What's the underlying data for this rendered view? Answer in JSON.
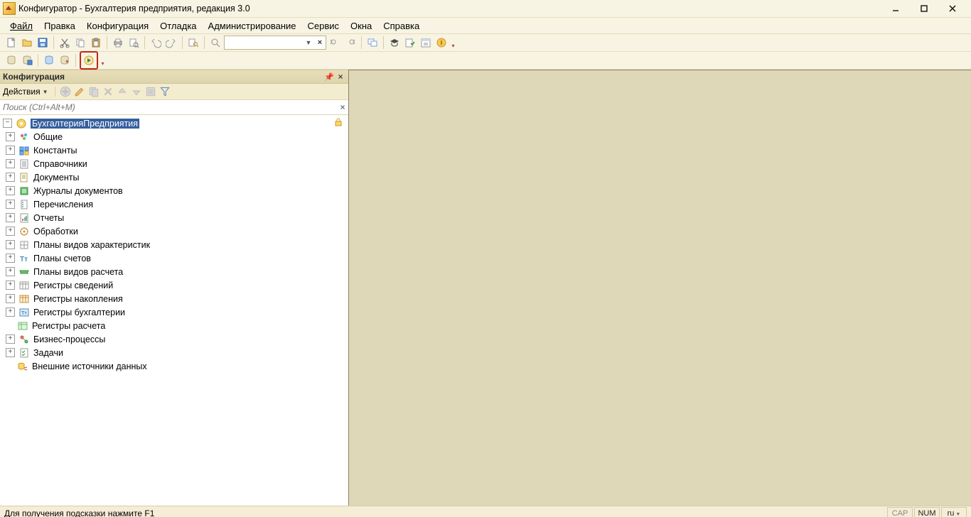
{
  "window": {
    "title": "Конфигуратор - Бухгалтерия предприятия, редакция 3.0"
  },
  "menu": {
    "file": "Файл",
    "edit": "Правка",
    "config": "Конфигурация",
    "debug": "Отладка",
    "admin": "Администрирование",
    "service": "Сервис",
    "windows": "Окна",
    "help": "Справка"
  },
  "search_box": {
    "value": ""
  },
  "panel": {
    "title": "Конфигурация",
    "actions_label": "Действия",
    "search_placeholder": "Поиск (Ctrl+Alt+M)"
  },
  "tree": {
    "root": "БухгалтерияПредприятия",
    "items": [
      {
        "label": "Общие",
        "expandable": true
      },
      {
        "label": "Константы",
        "expandable": true
      },
      {
        "label": "Справочники",
        "expandable": true
      },
      {
        "label": "Документы",
        "expandable": true
      },
      {
        "label": "Журналы документов",
        "expandable": true
      },
      {
        "label": "Перечисления",
        "expandable": true
      },
      {
        "label": "Отчеты",
        "expandable": true
      },
      {
        "label": "Обработки",
        "expandable": true
      },
      {
        "label": "Планы видов характеристик",
        "expandable": true
      },
      {
        "label": "Планы счетов",
        "expandable": true
      },
      {
        "label": "Планы видов расчета",
        "expandable": true
      },
      {
        "label": "Регистры сведений",
        "expandable": true
      },
      {
        "label": "Регистры накопления",
        "expandable": true
      },
      {
        "label": "Регистры бухгалтерии",
        "expandable": true
      },
      {
        "label": "Регистры расчета",
        "expandable": false
      },
      {
        "label": "Бизнес-процессы",
        "expandable": true
      },
      {
        "label": "Задачи",
        "expandable": true
      },
      {
        "label": "Внешние источники данных",
        "expandable": false
      }
    ]
  },
  "status": {
    "hint": "Для получения подсказки нажмите F1",
    "cap": "CAP",
    "num": "NUM",
    "lang": "ru"
  }
}
